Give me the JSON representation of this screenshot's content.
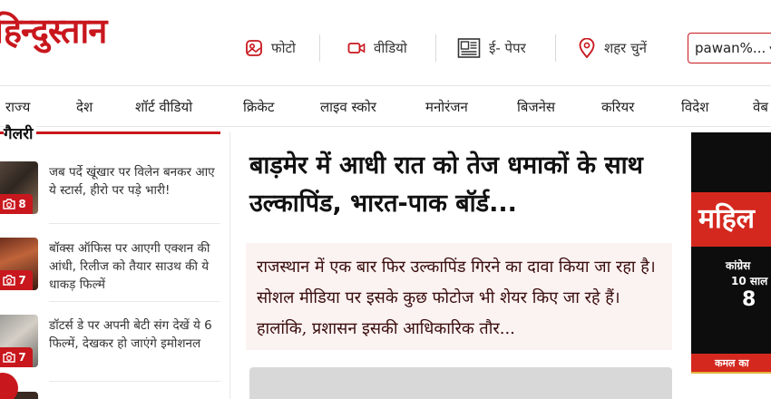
{
  "header": {
    "logo": "हिन्दुस्तान",
    "photo_label": "फोटो",
    "video_label": "वीडियो",
    "epaper_label": "ई- पेपर",
    "city_label": "शहर चुनें",
    "user_label": "pawan%..."
  },
  "nav": {
    "items": [
      "राज्य",
      "देश",
      "शॉर्ट वीडियो",
      "क्रिकेट",
      "लाइव स्कोर",
      "मनोरंजन",
      "बिजनेस",
      "करियर",
      "विदेश",
      "वेब"
    ]
  },
  "gallery": {
    "title": "गैलरी",
    "items": [
      {
        "count": "8",
        "text": "जब पर्दे खूंखार पर विलेन बनकर आए ये स्टार्स, हीरो पर पड़े भारी!"
      },
      {
        "count": "7",
        "text": "बॉक्स ऑफिस पर आएगी एक्शन की आंधी, रिलीज को तैयार साउथ की ये धाकड़ फिल्में"
      },
      {
        "count": "7",
        "text": "डॉटर्स डे पर अपनी बेटी संग देखें ये 6 फिल्में, देखकर हो जाएंगे इमोशनल"
      }
    ]
  },
  "article": {
    "headline": "बाड़मेर में आधी रात को तेज धमाकों के साथ उल्कापिंड, भारत-पाक बॉर्ड...",
    "summary": "राजस्थान में एक बार फिर उल्कापिंड गिरने का दावा किया जा रहा है। सोशल मीडिया पर इसके कुछ फोटोज भी शेयर किए जा रहे हैं। हालांकि, प्रशासन इसकी आधिकारिक तौर..."
  },
  "ad": {
    "headline": "महिल",
    "line1": "कांग्रेस",
    "line2": "10 साल",
    "line3": "8",
    "footer": "कमल का"
  },
  "colors": {
    "brand": "#c8171d",
    "summary_bg": "#fbf3f2",
    "ad_bg": "#0d0d0d"
  }
}
